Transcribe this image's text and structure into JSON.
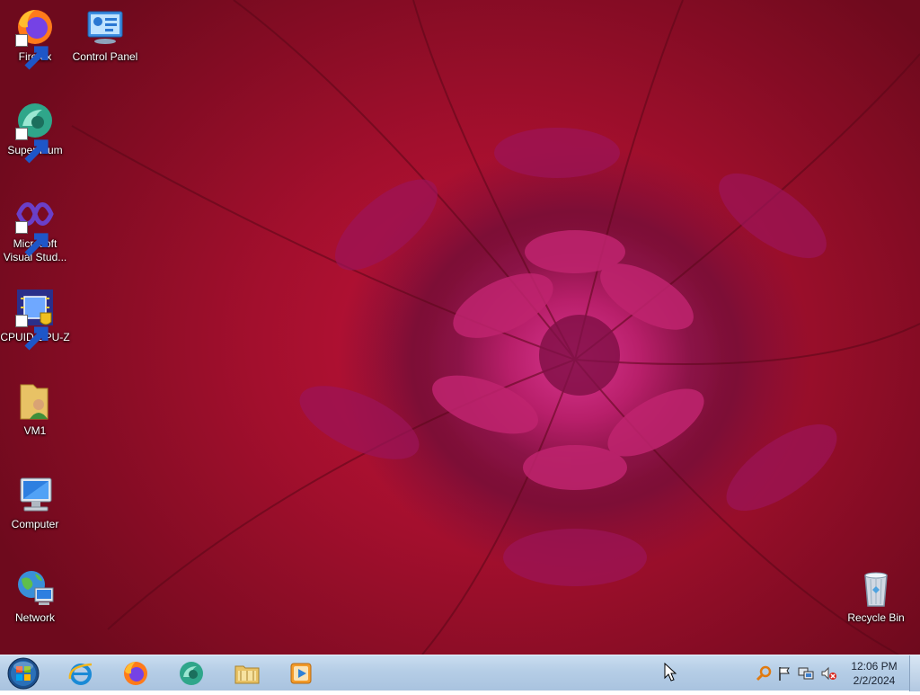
{
  "desktop": {
    "icons": [
      {
        "label": "Firefox"
      },
      {
        "label": "Control Panel"
      },
      {
        "label": "Supermium"
      },
      {
        "label": "Microsoft Visual Stud..."
      },
      {
        "label": "CPUID CPU-Z"
      },
      {
        "label": "VM1"
      },
      {
        "label": "Computer"
      },
      {
        "label": "Network"
      },
      {
        "label": "Recycle Bin"
      }
    ]
  },
  "taskbar": {
    "pinned": [
      "start-orb-icon",
      "internet-explorer-icon",
      "firefox-icon",
      "supermium-icon",
      "file-explorer-icon",
      "media-player-icon"
    ],
    "tray": [
      "search-icon",
      "action-center-flag-icon",
      "network-icon",
      "volume-muted-icon"
    ],
    "clock": {
      "time": "12:06 PM",
      "date": "2/2/2024"
    }
  },
  "colors": {
    "wallpaper_red": "#b3122f",
    "flower_magenta": "#c42a7c",
    "taskbar": "#b8d0e8"
  }
}
